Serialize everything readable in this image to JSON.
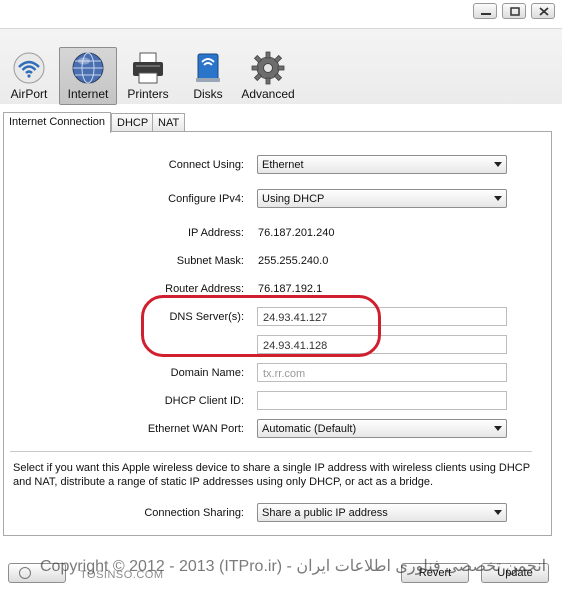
{
  "window": {
    "controls": [
      "minimize-icon",
      "maximize-icon",
      "close-icon"
    ]
  },
  "toolbar": {
    "items": [
      {
        "label": "AirPort",
        "icon": "airport-wifi-icon"
      },
      {
        "label": "Internet",
        "icon": "internet-globe-icon",
        "selected": true
      },
      {
        "label": "Printers",
        "icon": "printer-icon"
      },
      {
        "label": "Disks",
        "icon": "disk-drive-icon"
      },
      {
        "label": "Advanced",
        "icon": "gear-icon"
      }
    ]
  },
  "tabs": [
    {
      "label": "Internet Connection",
      "active": true
    },
    {
      "label": "DHCP"
    },
    {
      "label": "NAT"
    }
  ],
  "form": {
    "connect_using": {
      "label": "Connect Using:",
      "value": "Ethernet"
    },
    "configure_ipv4": {
      "label": "Configure IPv4:",
      "value": "Using DHCP"
    },
    "ip_address": {
      "label": "IP Address:",
      "value": "76.187.201.240"
    },
    "subnet_mask": {
      "label": "Subnet Mask:",
      "value": "255.255.240.0"
    },
    "router_address": {
      "label": "Router Address:",
      "value": "76.187.192.1"
    },
    "dns_servers": {
      "label": "DNS Server(s):",
      "primary": "24.93.41.127",
      "secondary": "24.93.41.128"
    },
    "domain_name": {
      "label": "Domain Name:",
      "placeholder": "tx.rr.com"
    },
    "dhcp_client_id": {
      "label": "DHCP Client ID:",
      "value": ""
    },
    "ethernet_wan_port": {
      "label": "Ethernet WAN Port:",
      "value": "Automatic (Default)"
    }
  },
  "sharing": {
    "description": "Select if you want this Apple wireless device to share a single IP address with wireless clients using DHCP and NAT, distribute a range of static IP addresses using only DHCP, or act as a bridge.",
    "label": "Connection Sharing:",
    "value": "Share a public IP address"
  },
  "buttons": {
    "revert": "Revert",
    "update": "Update"
  },
  "watermark": {
    "line1": "Copyright © 2012 - 2013 (ITPro.ir) - انجمن تخصصی فناوری اطلاعات ایران",
    "line2": "TOSINSO.COM"
  },
  "colors": {
    "highlight_ring": "#d01f2e",
    "toolbar_selected": "#c8c8c8"
  }
}
